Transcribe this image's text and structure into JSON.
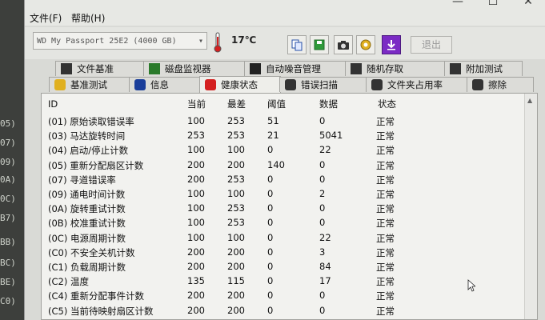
{
  "background_codes": [
    "05)",
    "07)",
    "09)",
    "0A)",
    "0C)",
    "B7)",
    "BB)",
    "BC)",
    "BE)",
    "C0)"
  ],
  "menu": {
    "file": "文件(F)",
    "help": "帮助(H)"
  },
  "toolbar": {
    "drive": "WD    My Passport 25E2 (4000 GB)",
    "temperature": "17℃",
    "exit_label": "退出"
  },
  "tabs_row1": [
    "文件基准",
    "磁盘监视器",
    "自动噪音管理",
    "随机存取",
    "附加测试"
  ],
  "tabs_row2": [
    "基准测试",
    "信息",
    "健康状态",
    "错误扫描",
    "文件夹占用率",
    "擦除"
  ],
  "active_tab": "健康状态",
  "table": {
    "headers": [
      "ID",
      "当前",
      "最差",
      "阈值",
      "数据",
      "状态"
    ],
    "rows": [
      [
        "(01) 原始读取错误率",
        "100",
        "253",
        "51",
        "0",
        "正常"
      ],
      [
        "(03) 马达旋转时间",
        "253",
        "253",
        "21",
        "5041",
        "正常"
      ],
      [
        "(04) 启动/停止计数",
        "100",
        "100",
        "0",
        "22",
        "正常"
      ],
      [
        "(05) 重新分配扇区计数",
        "200",
        "200",
        "140",
        "0",
        "正常"
      ],
      [
        "(07) 寻道错误率",
        "200",
        "253",
        "0",
        "0",
        "正常"
      ],
      [
        "(09) 通电时间计数",
        "100",
        "100",
        "0",
        "2",
        "正常"
      ],
      [
        "(0A) 旋转重试计数",
        "100",
        "253",
        "0",
        "0",
        "正常"
      ],
      [
        "(0B) 校准重试计数",
        "100",
        "253",
        "0",
        "0",
        "正常"
      ],
      [
        "(0C) 电源周期计数",
        "100",
        "100",
        "0",
        "22",
        "正常"
      ],
      [
        "(C0) 不安全关机计数",
        "200",
        "200",
        "0",
        "3",
        "正常"
      ],
      [
        "(C1) 负载周期计数",
        "200",
        "200",
        "0",
        "84",
        "正常"
      ],
      [
        "(C2) 温度",
        "135",
        "115",
        "0",
        "17",
        "正常"
      ],
      [
        "(C4) 重新分配事件计数",
        "200",
        "200",
        "0",
        "0",
        "正常"
      ],
      [
        "(C5) 当前待映射扇区计数",
        "200",
        "200",
        "0",
        "0",
        "正常"
      ]
    ]
  },
  "colors": {
    "window_bg": "#d9dad6",
    "panel_bg": "#f2f2ef",
    "exit_disabled": "#9a9a9a"
  },
  "icons": {
    "temperature": "thermometer-icon",
    "toolbar": [
      "copy-icon",
      "save-icon",
      "camera-icon",
      "settings-icon",
      "download-icon"
    ]
  }
}
